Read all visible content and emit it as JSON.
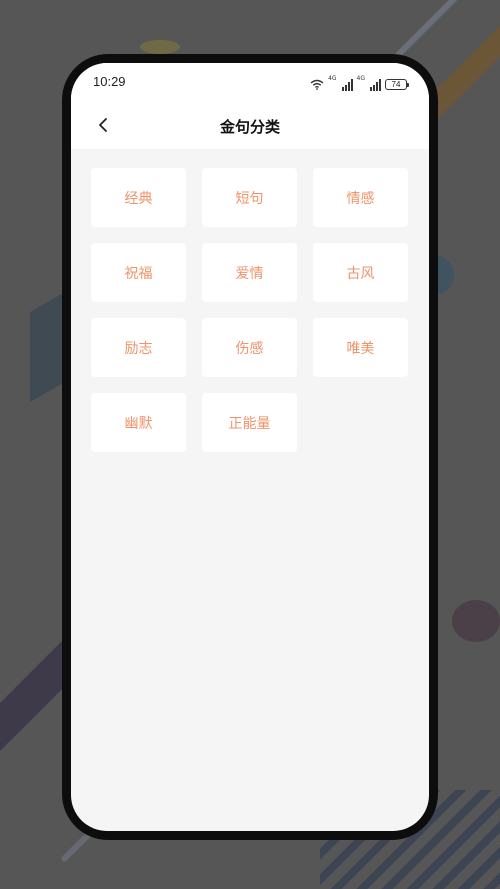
{
  "status_bar": {
    "time": "10:29",
    "net1": "4G",
    "net2": "4G",
    "battery": "74",
    "icons": [
      "wifi-icon",
      "signal-icon",
      "signal-icon",
      "battery-icon"
    ]
  },
  "header": {
    "title": "金句分类",
    "back_icon": "chevron-left-icon"
  },
  "categories": [
    {
      "label": "经典"
    },
    {
      "label": "短句"
    },
    {
      "label": "情感"
    },
    {
      "label": "祝福"
    },
    {
      "label": "爱情"
    },
    {
      "label": "古风"
    },
    {
      "label": "励志"
    },
    {
      "label": "伤感"
    },
    {
      "label": "唯美"
    },
    {
      "label": "幽默"
    },
    {
      "label": "正能量"
    }
  ],
  "colors": {
    "accent": "#f0936a",
    "page_bg": "#f5f5f5",
    "card_bg": "#ffffff"
  }
}
